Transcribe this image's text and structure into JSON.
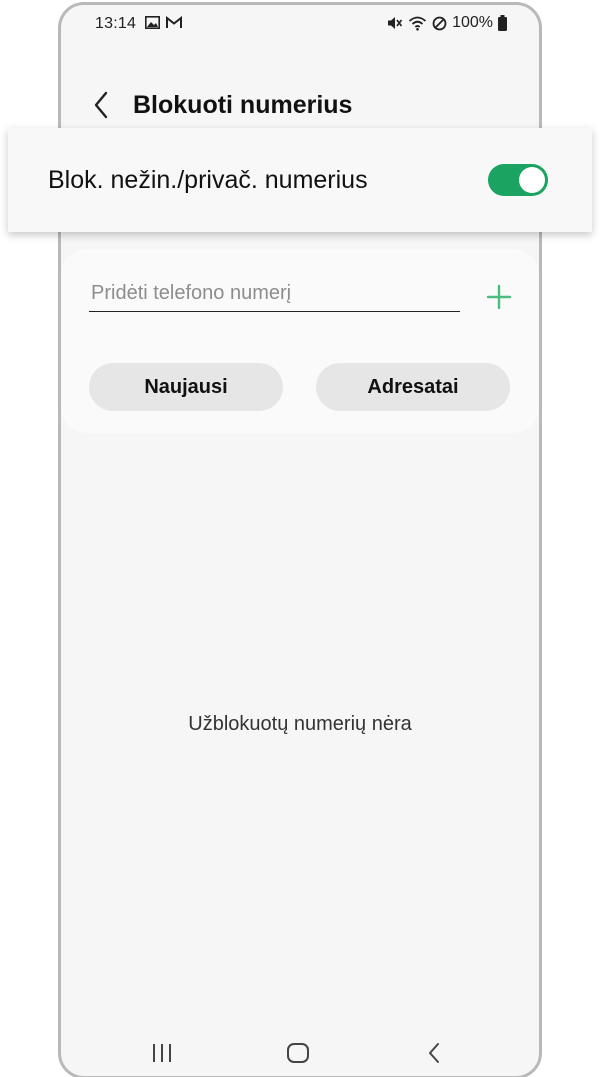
{
  "status_bar": {
    "time": "13:14",
    "battery": "100%",
    "icons": [
      "gallery-icon",
      "gmail-icon",
      "mute-icon",
      "wifi-icon",
      "no-disturb-icon",
      "battery-icon"
    ]
  },
  "header": {
    "title": "Blokuoti numerius",
    "back_icon": "chevron-left-icon"
  },
  "toggle_card": {
    "label": "Blok. nežin./privač. numerius",
    "enabled": true,
    "accent_color": "#1aa361"
  },
  "input_card": {
    "placeholder": "Pridėti telefono numerį",
    "value": "",
    "add_icon": "plus-icon",
    "add_icon_color": "#4cbb7f"
  },
  "buttons": {
    "recent_label": "Naujausi",
    "contacts_label": "Adresatai"
  },
  "empty_message": "Užblokuotų numerių nėra",
  "nav_bar": {
    "icons": [
      "recents-icon",
      "home-icon",
      "back-icon"
    ]
  }
}
